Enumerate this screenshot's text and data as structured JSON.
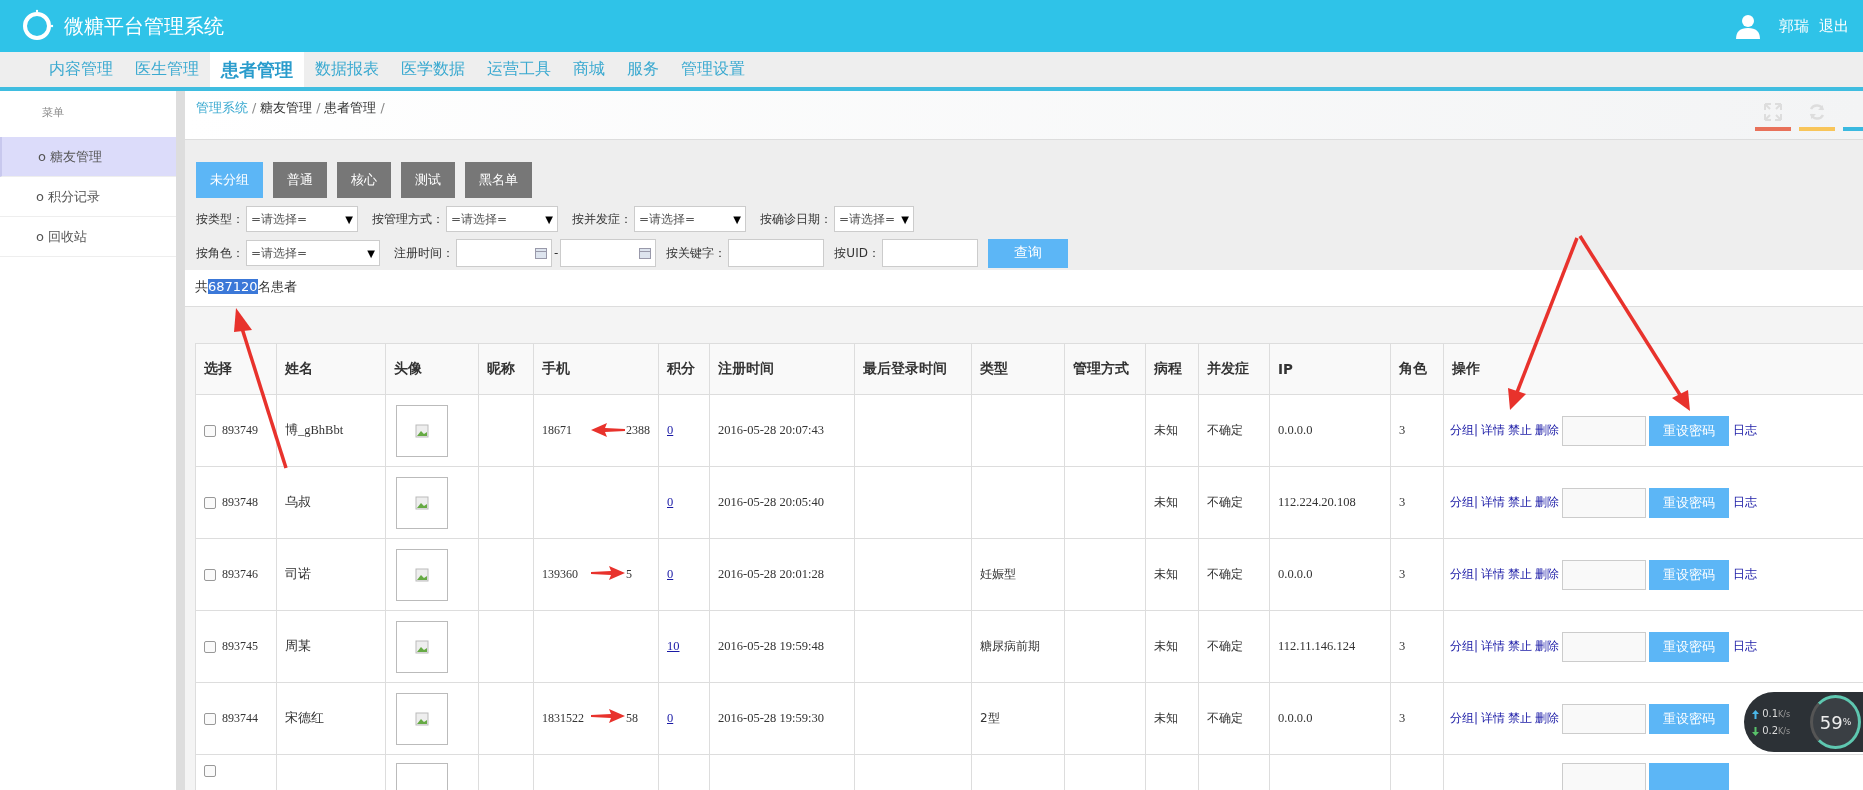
{
  "header": {
    "title": "微糖平台管理系统",
    "user": "郭瑞",
    "logout": "退出"
  },
  "nav": [
    {
      "label": "内容管理",
      "selected": false
    },
    {
      "label": "医生管理",
      "selected": false
    },
    {
      "label": "患者管理",
      "selected": true
    },
    {
      "label": "数据报表",
      "selected": false
    },
    {
      "label": "医学数据",
      "selected": false
    },
    {
      "label": "运营工具",
      "selected": false
    },
    {
      "label": "商城",
      "selected": false
    },
    {
      "label": "服务",
      "selected": false
    },
    {
      "label": "管理设置",
      "selected": false
    }
  ],
  "sidebar": {
    "title": "菜单",
    "items": [
      {
        "label": "o 糖友管理",
        "selected": true
      },
      {
        "label": "o 积分记录",
        "selected": false
      },
      {
        "label": "o 回收站",
        "selected": false
      }
    ]
  },
  "breadcrumb": [
    {
      "label": "管理系统",
      "kind": "link",
      "separator": "/"
    },
    {
      "label": "糖友管理",
      "kind": "text",
      "separator": "/"
    },
    {
      "label": "患者管理",
      "kind": "text",
      "separator": "/"
    }
  ],
  "groups": [
    {
      "label": "未分组",
      "selected": true
    },
    {
      "label": "普通",
      "selected": false
    },
    {
      "label": "核心",
      "selected": false
    },
    {
      "label": "测试",
      "selected": false
    },
    {
      "label": "黑名单",
      "selected": false
    }
  ],
  "filters": [
    [
      {
        "label": "按类型：",
        "kind": "select",
        "value": "=请选择=",
        "caret": "▼"
      },
      {
        "label": "按管理方式：",
        "kind": "select",
        "value": "=请选择=",
        "caret": "▼"
      },
      {
        "label": "按并发症：",
        "kind": "select",
        "value": "=请选择=",
        "caret": "▼"
      },
      {
        "label": "按确诊日期：",
        "kind": "select",
        "value": "=请选择=",
        "caret": "▼"
      }
    ],
    [
      {
        "label": "按角色：",
        "kind": "select",
        "value": "=请选择=",
        "caret": "▼"
      },
      {
        "label": "注册时间：",
        "kind": "daterange",
        "separator": "-"
      },
      {
        "label": "按关键字：",
        "kind": "input"
      },
      {
        "label": "按UID：",
        "kind": "input"
      },
      {
        "label": "查询",
        "kind": "button"
      }
    ]
  ],
  "count": {
    "prefix": "共",
    "number": "687120",
    "suffix": "名患者"
  },
  "table": {
    "columns": [
      "选择",
      "姓名",
      "头像",
      "昵称",
      "手机",
      "积分",
      "注册时间",
      "最后登录时间",
      "类型",
      "管理方式",
      "病程",
      "并发症",
      "IP",
      "角色",
      "操作"
    ],
    "rows": [
      {
        "checked": false,
        "id": "893749",
        "name": "博_gBhBbt",
        "phone": [
          "18671",
          "2388"
        ],
        "points": "0",
        "registered": "2016-05-28 20:07:43",
        "type": "",
        "course": "未知",
        "complication": "不确定",
        "ip": "0.0.0.0",
        "role": "3",
        "actions": [
          "分组|",
          "详情",
          "禁止",
          "删除"
        ],
        "reset": "重设密码",
        "log": "日志"
      },
      {
        "checked": false,
        "id": "893748",
        "name": "乌叔",
        "phone": [],
        "points": "0",
        "registered": "2016-05-28 20:05:40",
        "type": "",
        "course": "未知",
        "complication": "不确定",
        "ip": "112.224.20.108",
        "role": "3",
        "actions": [
          "分组|",
          "详情",
          "禁止",
          "删除"
        ],
        "reset": "重设密码",
        "log": "日志"
      },
      {
        "checked": false,
        "id": "893746",
        "name": "司诺",
        "phone": [
          "139360",
          "5"
        ],
        "points": "0",
        "registered": "2016-05-28 20:01:28",
        "type": "妊娠型",
        "course": "未知",
        "complication": "不确定",
        "ip": "0.0.0.0",
        "role": "3",
        "actions": [
          "分组|",
          "详情",
          "禁止",
          "删除"
        ],
        "reset": "重设密码",
        "log": "日志"
      },
      {
        "checked": false,
        "id": "893745",
        "name": "周某",
        "phone": [],
        "points": "10",
        "registered": "2016-05-28 19:59:48",
        "type": "糖尿病前期",
        "course": "未知",
        "complication": "不确定",
        "ip": "112.11.146.124",
        "role": "3",
        "actions": [
          "分组|",
          "详情",
          "禁止",
          "删除"
        ],
        "reset": "重设密码",
        "log": "日志"
      },
      {
        "checked": false,
        "id": "893744",
        "name": "宋德红",
        "phone": [
          "1831522",
          "58"
        ],
        "points": "0",
        "registered": "2016-05-28 19:59:30",
        "type": "2型",
        "course": "未知",
        "complication": "不确定",
        "ip": "0.0.0.0",
        "role": "3",
        "actions": [
          "分组|",
          "详情",
          "禁止",
          "删除"
        ],
        "reset": "重设密码"
      }
    ],
    "partial_row": {
      "checked": false
    }
  },
  "speed": {
    "up": "0.1",
    "up_unit": "K/s",
    "down": "0.2",
    "down_unit": "K/s",
    "percent": "59",
    "percent_unit": "%"
  }
}
